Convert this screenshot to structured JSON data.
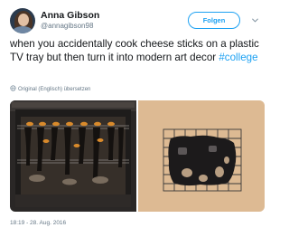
{
  "user": {
    "display_name": "Anna Gibson",
    "handle": "@annagibson98",
    "avatar_icon": "user-avatar"
  },
  "follow_button": {
    "label": "Folgen"
  },
  "tweet": {
    "text": "when you accidentally cook cheese sticks on a plastic TV tray but then turn it into modern art decor ",
    "hashtag": "#college"
  },
  "translate_link": "Original (Englisch) übersetzen",
  "media": {
    "photo_1": "oven-with-melted-tray",
    "photo_2": "melted-tray-on-rack"
  },
  "timestamp": "18:19 - 28. Aug. 2016",
  "colors": {
    "accent": "#1da1f2",
    "secondary_text": "#657786",
    "primary_text": "#14171a"
  }
}
